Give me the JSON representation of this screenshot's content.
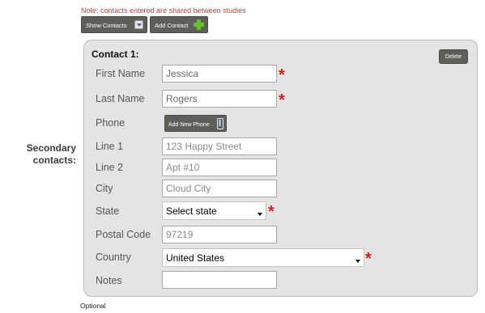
{
  "note": "Note: contacts entered are shared between studies",
  "toolbar": {
    "show_contacts_label": "Show Contacts",
    "show_contacts_icon": "download-icon",
    "add_contact_label": "Add Contact",
    "add_contact_icon": "plus-icon"
  },
  "section_label": "Secondary contacts:",
  "contact": {
    "title": "Contact 1:",
    "delete_label": "Delete",
    "fields": {
      "first_name": {
        "label": "First Name",
        "value": "Jessica"
      },
      "last_name": {
        "label": "Last Name",
        "value": "Rogers"
      },
      "phone": {
        "label": "Phone",
        "add_button_label": "Add New Phone",
        "icon": "mobile-phone-icon"
      },
      "line1": {
        "label": "Line 1",
        "placeholder": "123 Happy Street"
      },
      "line2": {
        "label": "Line 2",
        "placeholder": "Apt #10"
      },
      "city": {
        "label": "City",
        "placeholder": "Cloud City"
      },
      "state": {
        "label": "State",
        "selected": "Select state"
      },
      "postal_code": {
        "label": "Postal Code",
        "placeholder": "97219"
      },
      "country": {
        "label": "Country",
        "selected": "United States"
      },
      "notes": {
        "label": "Notes",
        "value": ""
      }
    },
    "required_marker": "*"
  },
  "footer_note": "Optional",
  "colors": {
    "note_red": "#d23a2a",
    "required_red": "#e01b1b",
    "button_dark": "#5f5f5a",
    "panel_bg": "#e4e4e4",
    "add_green": "#6bbf2a"
  }
}
